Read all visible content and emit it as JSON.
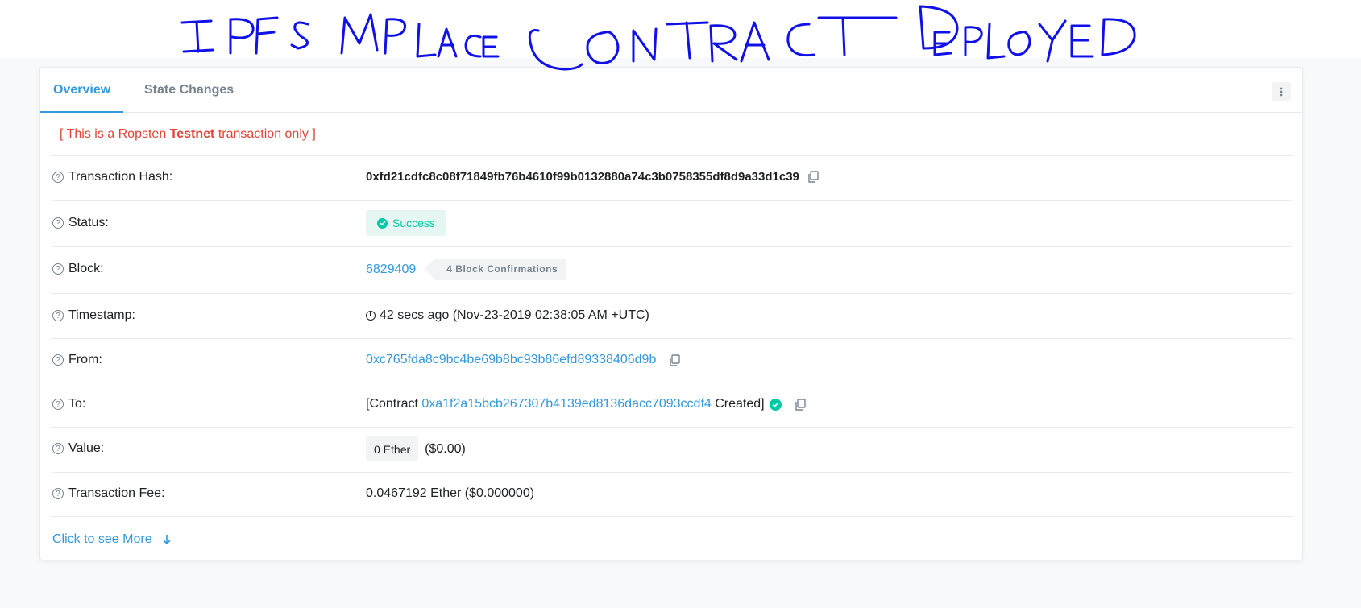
{
  "handwritten_note": "IPFS MPLACE CONTRACT DEPLOYED",
  "tabs": [
    {
      "label": "Overview",
      "active": true
    },
    {
      "label": "State Changes",
      "active": false
    }
  ],
  "menu_icon": "more-vertical-icon",
  "testnet_notice": {
    "prefix": "[ This is a Ropsten ",
    "highlight": "Testnet",
    "suffix": " transaction only ]"
  },
  "rows": {
    "hash": {
      "label": "Transaction Hash:",
      "value": "0xfd21cdfc8c08f71849fb76b4610f99b0132880a74c3b0758355df8d9a33d1c39"
    },
    "status": {
      "label": "Status:",
      "value": "Success"
    },
    "block": {
      "label": "Block:",
      "value": "6829409",
      "confirmations": "4 Block Confirmations"
    },
    "timestamp": {
      "label": "Timestamp:",
      "value": "42 secs ago (Nov-23-2019 02:38:05 AM +UTC)"
    },
    "from": {
      "label": "From:",
      "value": "0xc765fda8c9bc4be69b8bc93b86efd89338406d9b"
    },
    "to": {
      "label": "To:",
      "prefix": "[Contract ",
      "address": "0xa1f2a15bcb267307b4139ed8136dacc7093ccdf4",
      "suffix": " Created]"
    },
    "value": {
      "label": "Value:",
      "ether": "0 Ether",
      "usd": "($0.00)"
    },
    "fee": {
      "label": "Transaction Fee:",
      "value": "0.0467192 Ether ($0.000000)"
    }
  },
  "see_more": "Click to see More",
  "colors": {
    "accent": "#3498db",
    "success": "#00c9a7",
    "danger": "#de4437",
    "ink": "#0000ff"
  }
}
